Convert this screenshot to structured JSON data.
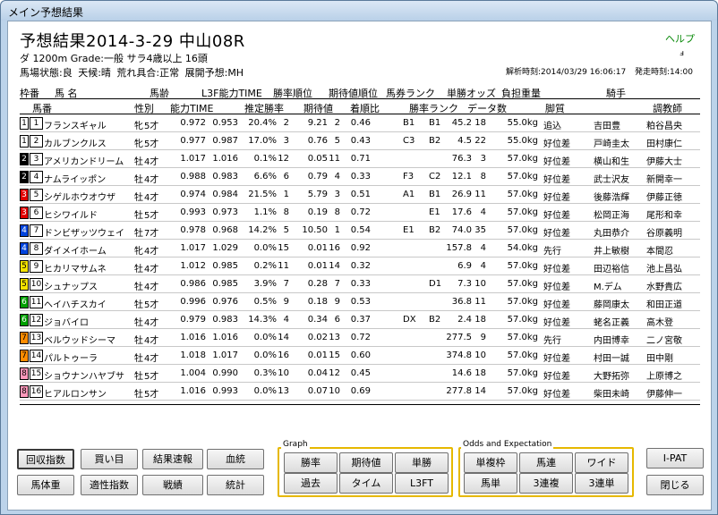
{
  "window": {
    "title": "メイン予想結果"
  },
  "header": {
    "title": "予想結果2014-3-29 中山08R",
    "help": "ヘルプ",
    "race_info": "ダ 1200m Grade:一般 サラ4歳以上 16頭",
    "track_info": "馬場状態:良 天候:晴 荒れ具合:正常 展開予想:MH",
    "analysis_time": "解析時刻:2014/03/29 16:06:17",
    "post_time": "発走時刻:14:00",
    "icon_label": "ⅎ"
  },
  "columns_row1": [
    "枠番",
    "馬 名",
    "馬齢",
    "L3F能力TIME",
    "勝率順位",
    "期待値順位",
    "馬券ランク",
    "単勝オッズ",
    "負担重量",
    "騎手"
  ],
  "columns_row2": [
    "馬番",
    "性別",
    "能力TIME",
    "推定勝率",
    "期待値",
    "着順比",
    "勝率ランク",
    "データ数",
    "脚質",
    "調教師"
  ],
  "frame_colors": {
    "1": "#ffffff",
    "2": "#000000",
    "3": "#e00000",
    "4": "#0044dd",
    "5": "#f5e400",
    "6": "#00a000",
    "7": "#ff8c00",
    "8": "#ff99bb"
  },
  "horses": [
    {
      "frame": "1",
      "num": "1",
      "name": "フランスギャル",
      "sex": "牝",
      "age": "5才",
      "ability": "0.972",
      "l3f": "0.953",
      "winrate": "20.4%",
      "winrank": "2",
      "expect": "9.21",
      "exprank": "2",
      "ratio": "0.46",
      "baken": "B1",
      "rank": "B1",
      "odds": "45.2",
      "data": "18",
      "weight": "55.0kg",
      "style": "追込",
      "jockey": "吉田豊",
      "trainer": "粕谷昌央"
    },
    {
      "frame": "1",
      "num": "2",
      "name": "カルブンクルス",
      "sex": "牝",
      "age": "5才",
      "ability": "0.977",
      "l3f": "0.987",
      "winrate": "17.0%",
      "winrank": "3",
      "expect": "0.76",
      "exprank": "5",
      "ratio": "0.43",
      "baken": "C3",
      "rank": "B2",
      "odds": "4.5",
      "data": "22",
      "weight": "55.0kg",
      "style": "好位差",
      "jockey": "戸崎圭太",
      "trainer": "田村康仁"
    },
    {
      "frame": "2",
      "num": "3",
      "name": "アメリカンドリーム",
      "sex": "牡",
      "age": "4才",
      "ability": "1.017",
      "l3f": "1.016",
      "winrate": "0.1%",
      "winrank": "12",
      "expect": "0.05",
      "exprank": "11",
      "ratio": "0.71",
      "baken": "",
      "rank": "",
      "odds": "76.3",
      "data": "3",
      "weight": "57.0kg",
      "style": "好位差",
      "jockey": "横山和生",
      "trainer": "伊藤大士"
    },
    {
      "frame": "2",
      "num": "4",
      "name": "ナムライッポン",
      "sex": "牡",
      "age": "4才",
      "ability": "0.988",
      "l3f": "0.983",
      "winrate": "6.6%",
      "winrank": "6",
      "expect": "0.79",
      "exprank": "4",
      "ratio": "0.33",
      "baken": "F3",
      "rank": "C2",
      "odds": "12.1",
      "data": "8",
      "weight": "57.0kg",
      "style": "好位差",
      "jockey": "武士沢友",
      "trainer": "新開幸一"
    },
    {
      "frame": "3",
      "num": "5",
      "name": "シゲルホウオウザ",
      "sex": "牡",
      "age": "4才",
      "ability": "0.974",
      "l3f": "0.984",
      "winrate": "21.5%",
      "winrank": "1",
      "expect": "5.79",
      "exprank": "3",
      "ratio": "0.51",
      "baken": "A1",
      "rank": "B1",
      "odds": "26.9",
      "data": "11",
      "weight": "57.0kg",
      "style": "好位差",
      "jockey": "後藤浩輝",
      "trainer": "伊藤正徳"
    },
    {
      "frame": "3",
      "num": "6",
      "name": "ヒシワイルド",
      "sex": "牡",
      "age": "5才",
      "ability": "0.993",
      "l3f": "0.973",
      "winrate": "1.1%",
      "winrank": "8",
      "expect": "0.19",
      "exprank": "8",
      "ratio": "0.72",
      "baken": "",
      "rank": "E1",
      "odds": "17.6",
      "data": "4",
      "weight": "57.0kg",
      "style": "好位差",
      "jockey": "松岡正海",
      "trainer": "尾形和幸"
    },
    {
      "frame": "4",
      "num": "7",
      "name": "ドンビザッツウェイ",
      "sex": "牡",
      "age": "7才",
      "ability": "0.978",
      "l3f": "0.968",
      "winrate": "14.2%",
      "winrank": "5",
      "expect": "10.50",
      "exprank": "1",
      "ratio": "0.54",
      "baken": "E1",
      "rank": "B2",
      "odds": "74.0",
      "data": "35",
      "weight": "57.0kg",
      "style": "好位差",
      "jockey": "丸田恭介",
      "trainer": "谷原義明"
    },
    {
      "frame": "4",
      "num": "8",
      "name": "ダイメイホーム",
      "sex": "牝",
      "age": "4才",
      "ability": "1.017",
      "l3f": "1.029",
      "winrate": "0.0%",
      "winrank": "15",
      "expect": "0.01",
      "exprank": "16",
      "ratio": "0.92",
      "baken": "",
      "rank": "",
      "odds": "157.8",
      "data": "4",
      "weight": "54.0kg",
      "style": "先行",
      "jockey": "井上敏樹",
      "trainer": "本間忍"
    },
    {
      "frame": "5",
      "num": "9",
      "name": "ヒカリマサムネ",
      "sex": "牡",
      "age": "4才",
      "ability": "1.012",
      "l3f": "0.985",
      "winrate": "0.2%",
      "winrank": "11",
      "expect": "0.01",
      "exprank": "14",
      "ratio": "0.32",
      "baken": "",
      "rank": "",
      "odds": "6.9",
      "data": "4",
      "weight": "57.0kg",
      "style": "好位差",
      "jockey": "田辺裕信",
      "trainer": "池上昌弘"
    },
    {
      "frame": "5",
      "num": "10",
      "name": "シュナップス",
      "sex": "牡",
      "age": "4才",
      "ability": "0.986",
      "l3f": "0.985",
      "winrate": "3.9%",
      "winrank": "7",
      "expect": "0.28",
      "exprank": "7",
      "ratio": "0.33",
      "baken": "",
      "rank": "D1",
      "odds": "7.3",
      "data": "10",
      "weight": "57.0kg",
      "style": "好位差",
      "jockey": "M.デム",
      "trainer": "水野貴広"
    },
    {
      "frame": "6",
      "num": "11",
      "name": "ヘイハチスカイ",
      "sex": "牡",
      "age": "5才",
      "ability": "0.996",
      "l3f": "0.976",
      "winrate": "0.5%",
      "winrank": "9",
      "expect": "0.18",
      "exprank": "9",
      "ratio": "0.53",
      "baken": "",
      "rank": "",
      "odds": "36.8",
      "data": "11",
      "weight": "57.0kg",
      "style": "好位差",
      "jockey": "藤岡康太",
      "trainer": "和田正道"
    },
    {
      "frame": "6",
      "num": "12",
      "name": "ジョバイロ",
      "sex": "牡",
      "age": "4才",
      "ability": "0.979",
      "l3f": "0.983",
      "winrate": "14.3%",
      "winrank": "4",
      "expect": "0.34",
      "exprank": "6",
      "ratio": "0.37",
      "baken": "DX",
      "rank": "B2",
      "odds": "2.4",
      "data": "18",
      "weight": "57.0kg",
      "style": "好位差",
      "jockey": "蛯名正義",
      "trainer": "高木登"
    },
    {
      "frame": "7",
      "num": "13",
      "name": "ベルウッドシーマ",
      "sex": "牡",
      "age": "4才",
      "ability": "1.016",
      "l3f": "1.016",
      "winrate": "0.0%",
      "winrank": "14",
      "expect": "0.02",
      "exprank": "13",
      "ratio": "0.72",
      "baken": "",
      "rank": "",
      "odds": "277.5",
      "data": "9",
      "weight": "57.0kg",
      "style": "先行",
      "jockey": "内田博幸",
      "trainer": "二ノ宮敬"
    },
    {
      "frame": "7",
      "num": "14",
      "name": "パルトゥーラ",
      "sex": "牡",
      "age": "4才",
      "ability": "1.018",
      "l3f": "1.017",
      "winrate": "0.0%",
      "winrank": "16",
      "expect": "0.01",
      "exprank": "15",
      "ratio": "0.60",
      "baken": "",
      "rank": "",
      "odds": "374.8",
      "data": "10",
      "weight": "57.0kg",
      "style": "好位差",
      "jockey": "村田一誠",
      "trainer": "田中剛"
    },
    {
      "frame": "8",
      "num": "15",
      "name": "ショウナンハヤブサ",
      "sex": "牡",
      "age": "5才",
      "ability": "1.004",
      "l3f": "0.990",
      "winrate": "0.3%",
      "winrank": "10",
      "expect": "0.04",
      "exprank": "12",
      "ratio": "0.45",
      "baken": "",
      "rank": "",
      "odds": "14.6",
      "data": "18",
      "weight": "57.0kg",
      "style": "好位差",
      "jockey": "大野拓弥",
      "trainer": "上原博之"
    },
    {
      "frame": "8",
      "num": "16",
      "name": "ヒアルロンサン",
      "sex": "牡",
      "age": "5才",
      "ability": "1.016",
      "l3f": "0.993",
      "winrate": "0.0%",
      "winrank": "13",
      "expect": "0.07",
      "exprank": "10",
      "ratio": "0.69",
      "baken": "",
      "rank": "",
      "odds": "277.8",
      "data": "14",
      "weight": "57.0kg",
      "style": "好位差",
      "jockey": "柴田未崎",
      "trainer": "伊藤伸一"
    }
  ],
  "buttons": {
    "kaishu": "回収指数",
    "kaime": "買い目",
    "kekka": "結果速報",
    "kettou": "血統",
    "bataiju": "馬体重",
    "tekisei": "適性指数",
    "senseki": "戦績",
    "toukei": "統計",
    "ipat": "I-PAT",
    "close": "閉じる"
  },
  "graph_group": {
    "label": "Graph",
    "buttons": [
      "勝率",
      "期待値",
      "単勝",
      "過去",
      "タイム",
      "L3FT"
    ]
  },
  "odds_group": {
    "label": "Odds and Expectation",
    "buttons": [
      "単複枠",
      "馬連",
      "ワイド",
      "馬単",
      "3連複",
      "3連単"
    ]
  }
}
